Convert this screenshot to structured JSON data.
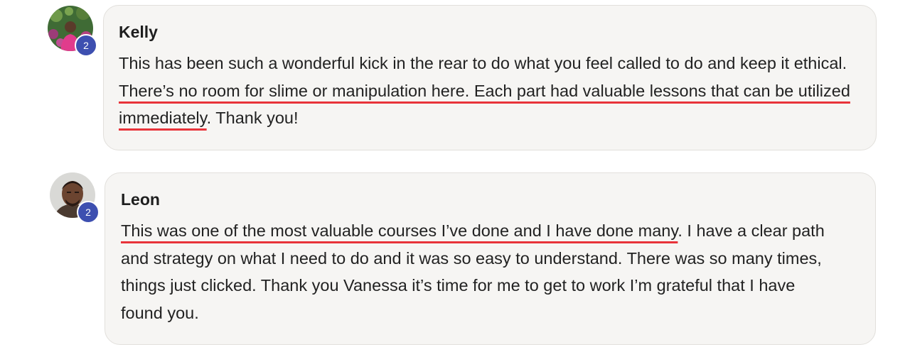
{
  "comments": [
    {
      "author": "Kelly",
      "badge": "2",
      "text_before": "This has been such a wonderful kick in the rear to do what you feel called to do and keep it ethical. ",
      "text_highlight": "There’s no room for slime or manipulation here. Each part had valuable lessons that can be utilized immediately",
      "text_after": ". Thank you!"
    },
    {
      "author": "Leon",
      "badge": "2",
      "text_before": "",
      "text_highlight": "This was one of the most valuable courses I’ve done and I have done many",
      "text_after": ". I have a clear path and strategy on what I need to do and it was so easy to understand. There was so many times, things just clicked. Thank you Vanessa it’s time for me to get to work I’m grateful that I have found you."
    }
  ],
  "colors": {
    "underline": "#e8333a",
    "badge": "#3d4fb0",
    "bubble_bg": "#f6f5f3"
  }
}
